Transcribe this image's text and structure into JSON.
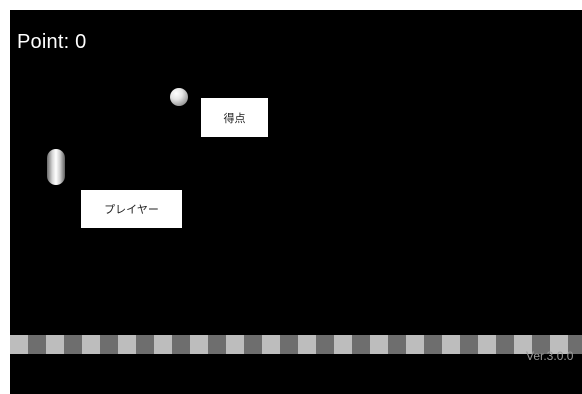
{
  "hud": {
    "score_text": "Point: 0",
    "version_text": "Ver.3.0.0"
  },
  "labels": {
    "point_label": "得点",
    "player_label": "プレイヤー"
  },
  "objects": {
    "ball": "sphere-ball",
    "player": "capsule-player",
    "floor": "checkered-floor"
  },
  "colors": {
    "background": "#000000",
    "text": "#ffffff",
    "label_background": "#ffffff",
    "floor_light": "#bdbdbd",
    "floor_dark": "#6e6e6e"
  }
}
